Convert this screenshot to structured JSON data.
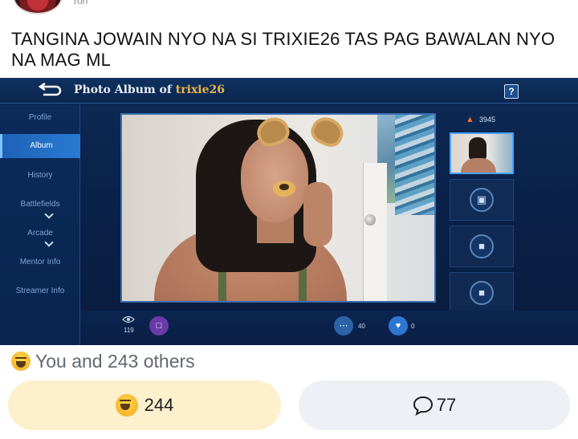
{
  "post": {
    "author_fragment": "ron",
    "caption": "TANGINA JOWAIN NYO NA SI TRIXIE26 TAS PAG BAWALAN NYO NA MAG ML"
  },
  "game": {
    "title_prefix": "Photo Album of ",
    "username": "trixie26",
    "help_label": "?",
    "sidebar": [
      {
        "label": "Profile"
      },
      {
        "label": "Album"
      },
      {
        "label": "History"
      },
      {
        "label": "Battlefields"
      },
      {
        "label": "Arcade"
      },
      {
        "label": "Mentor Info"
      },
      {
        "label": "Streamer Info"
      }
    ],
    "like_count": "3945",
    "bottom": {
      "view_count": "119",
      "comment_count": "40",
      "heart_count": "0"
    }
  },
  "reactions": {
    "summary": "You and 243 others",
    "haha_count": "244",
    "comment_count": "77"
  },
  "colors": {
    "accent": "#e9b649",
    "game_bg": "#0d2a56",
    "haha_pill": "#fdf0cc",
    "comment_pill": "#eef0f5"
  },
  "icons": [
    "back-arrow-icon",
    "help-icon",
    "fire-icon",
    "camera-icon",
    "lock-icon",
    "eye-icon",
    "gift-icon",
    "chat-icon",
    "heart-icon",
    "haha-emoji-icon",
    "comment-icon"
  ]
}
